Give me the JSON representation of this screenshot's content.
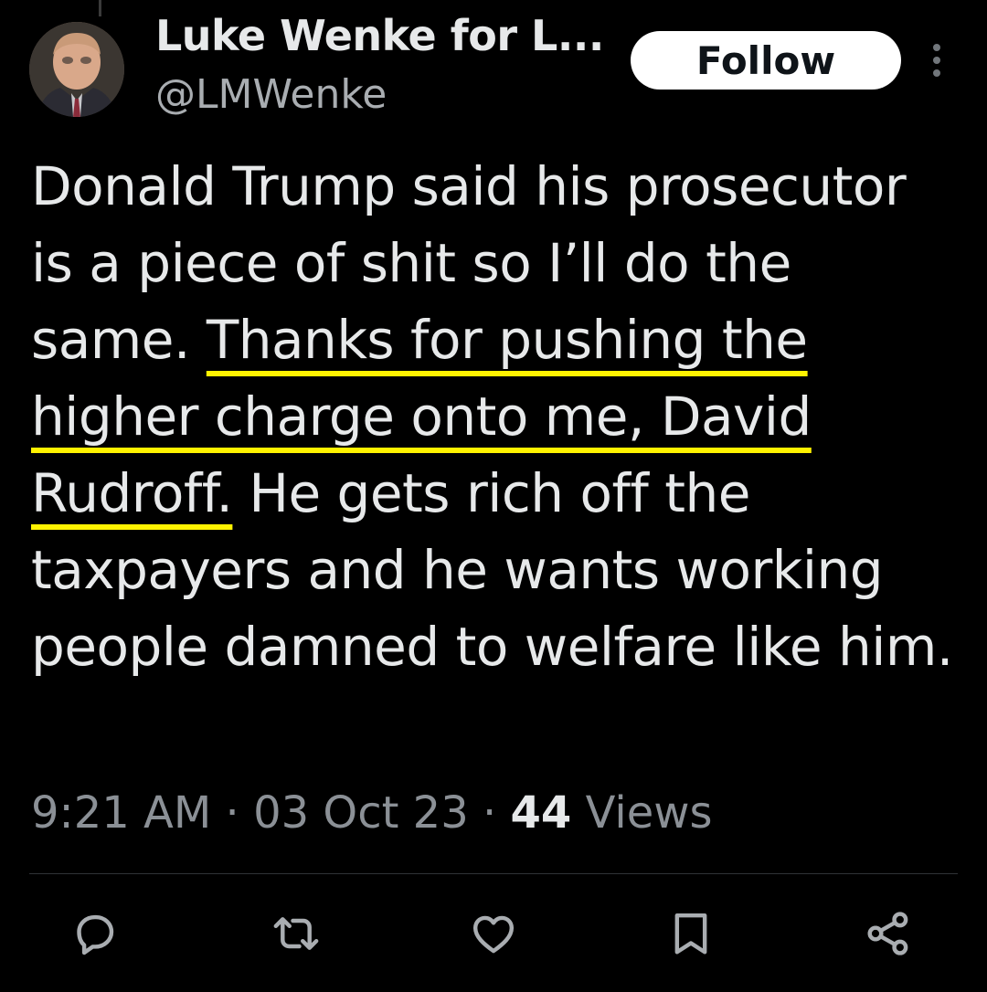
{
  "profile": {
    "display_name": "Luke Wenke for L...",
    "handle": "@LMWenke",
    "avatar_icon": "profile-photo"
  },
  "header": {
    "follow_label": "Follow",
    "more_icon": "more-vertical-icon"
  },
  "tweet": {
    "segments": [
      {
        "text": "Donald Trump said his prosecutor is a piece of shit so I’ll do the same.  ",
        "highlight": false
      },
      {
        "text": "Thanks for pushing the higher charge onto me, David Rudroff.",
        "highlight": true
      },
      {
        "text": "  He gets rich off the taxpayers and he wants working people damned to welfare like him.",
        "highlight": false
      }
    ],
    "highlight_color": "#fff200"
  },
  "meta": {
    "time": "9:21 AM",
    "separator": " · ",
    "date": "03 Oct 23",
    "views_count": "44",
    "views_label": " Views"
  },
  "actions": [
    {
      "name": "reply",
      "icon": "reply-icon"
    },
    {
      "name": "retweet",
      "icon": "retweet-icon"
    },
    {
      "name": "like",
      "icon": "heart-icon"
    },
    {
      "name": "bookmark",
      "icon": "bookmark-icon"
    },
    {
      "name": "share",
      "icon": "share-icon"
    }
  ],
  "colors": {
    "background": "#000000",
    "text": "#e7e9ea",
    "secondary": "#8b9096",
    "action_icon": "#a9adb1"
  }
}
